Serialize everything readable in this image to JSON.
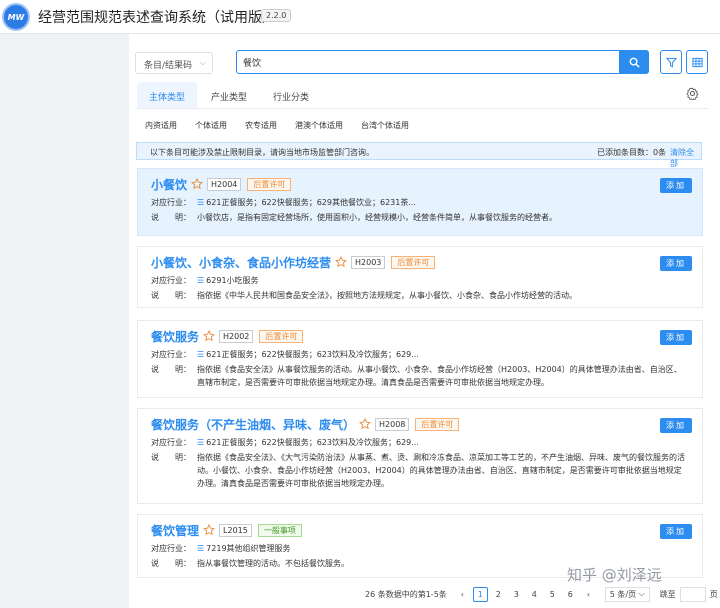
{
  "app": {
    "logo_text": "MW",
    "title": "经营范围规范表述查询系统（试用版）",
    "version": "2.2.0"
  },
  "search": {
    "type_selected": "条目/结果码",
    "query": "餐饮",
    "search_icon": "search-icon",
    "filter_icon": "funnel-icon",
    "table_icon": "table-icon"
  },
  "tabs": [
    {
      "label": "主体类型",
      "active": true
    },
    {
      "label": "产业类型",
      "active": false
    },
    {
      "label": "行业分类",
      "active": false
    }
  ],
  "sub_filters": [
    "内资适用",
    "个体适用",
    "农专适用",
    "港澳个体适用",
    "台湾个体适用"
  ],
  "notice": {
    "warning": "以下条目可能涉及禁止限制目录，请询当地市场监管部门咨询。",
    "added_count": "已添加条目数：0条",
    "clear_label": "清除全部"
  },
  "labels": {
    "industry": "对应行业：",
    "desc": "说　　明：",
    "add": "添加"
  },
  "results": [
    {
      "title": "小餐饮",
      "code": "H2004",
      "status": "后置许可",
      "industry": "621正餐服务；622快餐服务；629其他餐饮业；6231茶...",
      "desc": "小餐饮店，是指有固定经营场所，使用面积小，经营规模小，经营条件简单，从事餐饮服务的经营者。"
    },
    {
      "title": "小餐饮、小食杂、食品小作坊经营",
      "code": "H2003",
      "status": "后置许可",
      "industry": "6291小吃服务",
      "desc": "指依据《中华人民共和国食品安全法》，按照地方法规规定，从事小餐饮、小食杂、食品小作坊经营的活动。"
    },
    {
      "title": "餐饮服务",
      "code": "H2002",
      "status": "后置许可",
      "industry": "621正餐服务；622快餐服务；623饮料及冷饮服务；629...",
      "desc": "指依据《食品安全法》从事餐饮服务的活动。从事小餐饮、小食杂、食品小作坊经营（H2003、H2004）的具体管理办法由省、自治区、直辖市制定，是否需要许可审批依据当地规定办理。清真食品是否需要许可审批依据当地规定办理。"
    },
    {
      "title": "餐饮服务（不产生油烟、异味、废气）",
      "code": "H2008",
      "status": "后置许可",
      "industry": "621正餐服务；622快餐服务；623饮料及冷饮服务；629...",
      "desc": "指依据《食品安全法》、《大气污染防治法》从事蒸、煮、烫、涮和冷冻食品、凉菜加工等工艺的，不产生油烟、异味、废气的餐饮服务的活动。小餐饮、小食杂、食品小作坊经营（H2003、H2004）的具体管理办法由省、自治区、直辖市制定，是否需要许可审批依据当地规定办理。清真食品是否需要许可审批依据当地规定办理。"
    },
    {
      "title": "餐饮管理",
      "code": "L2015",
      "status": "一般事项",
      "industry": "7219其他组织管理服务",
      "desc": "指从事餐饮管理的活动。不包括餐饮服务。"
    }
  ],
  "pagination": {
    "summary": "26 条数据中的第1-5条",
    "pages": [
      "1",
      "2",
      "3",
      "4",
      "5",
      "6"
    ],
    "current": "1",
    "page_size": "5 条/页",
    "jump_label": "跳至",
    "page_unit": "页"
  },
  "watermark": "知乎 @刘泽远",
  "colors": {
    "primary": "#2d8cf0",
    "highlight": "#e6f2fe",
    "tag_orange": "#e98b3a",
    "tag_green": "#3f9a23"
  }
}
